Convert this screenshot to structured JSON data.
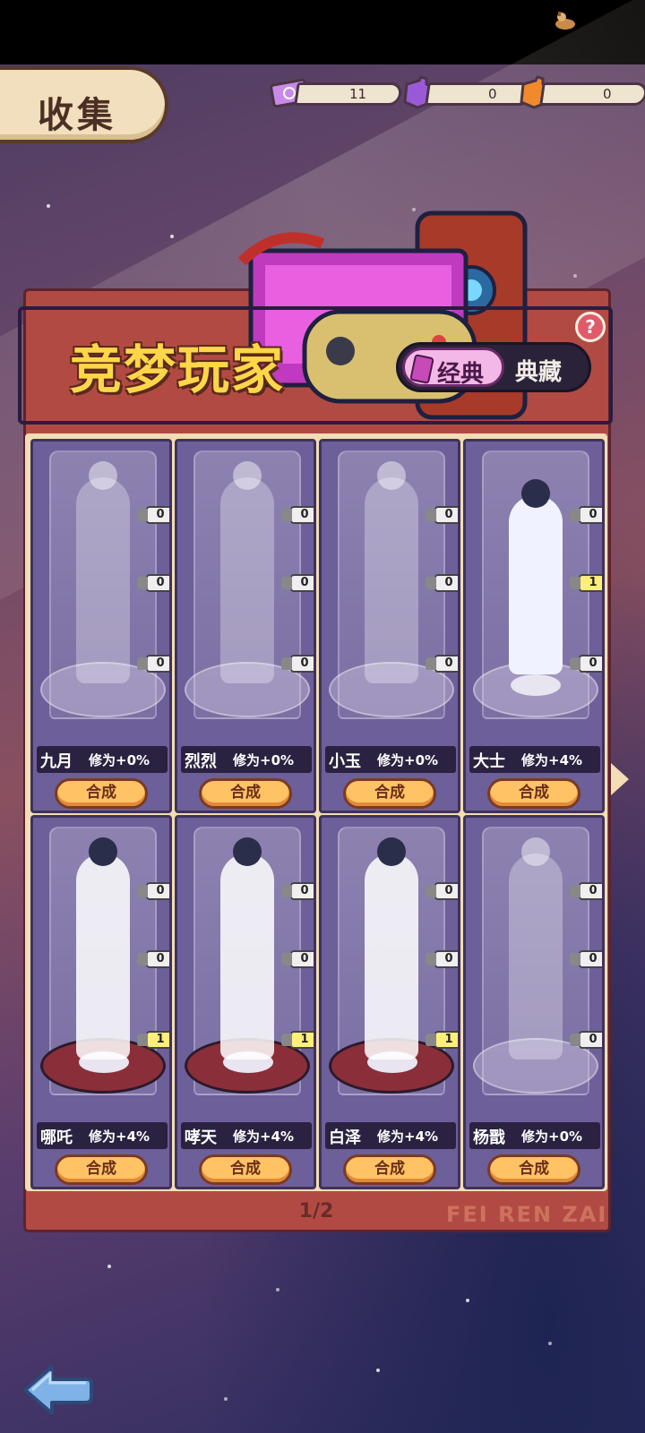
{
  "header": {
    "title": "收集",
    "currencies": [
      {
        "icon": "purple-ticket-icon",
        "value": "11",
        "color": "#c88ae8"
      },
      {
        "icon": "purple-puzzle-icon",
        "value": "0",
        "color": "#9a5ad8"
      },
      {
        "icon": "orange-puzzle-icon",
        "value": "0",
        "color": "#f08a2a"
      }
    ]
  },
  "banner": {
    "title": "竞梦玩家",
    "tabs": {
      "active": "经典",
      "inactive": "典藏"
    },
    "help": "?"
  },
  "cards": [
    {
      "name": "九月",
      "bonus": "修为+0%",
      "counts": [
        "0",
        "0",
        "0"
      ],
      "button": "合成",
      "owned": false
    },
    {
      "name": "烈烈",
      "bonus": "修为+0%",
      "counts": [
        "0",
        "0",
        "0"
      ],
      "button": "合成",
      "owned": false
    },
    {
      "name": "小玉",
      "bonus": "修为+0%",
      "counts": [
        "0",
        "0",
        "0"
      ],
      "button": "合成",
      "owned": false
    },
    {
      "name": "大士",
      "bonus": "修为+4%",
      "counts": [
        "0",
        "1",
        "0"
      ],
      "button": "合成",
      "owned": true
    },
    {
      "name": "哪吒",
      "bonus": "修为+4%",
      "counts": [
        "0",
        "0",
        "1"
      ],
      "button": "合成",
      "owned": true
    },
    {
      "name": "哮天",
      "bonus": "修为+4%",
      "counts": [
        "0",
        "0",
        "1"
      ],
      "button": "合成",
      "owned": true
    },
    {
      "name": "白泽",
      "bonus": "修为+4%",
      "counts": [
        "0",
        "0",
        "1"
      ],
      "button": "合成",
      "owned": true
    },
    {
      "name": "杨戬",
      "bonus": "修为+0%",
      "counts": [
        "0",
        "0",
        "0"
      ],
      "button": "合成",
      "owned": false
    }
  ],
  "pager": "1/2",
  "watermark": "FEI REN ZAI"
}
